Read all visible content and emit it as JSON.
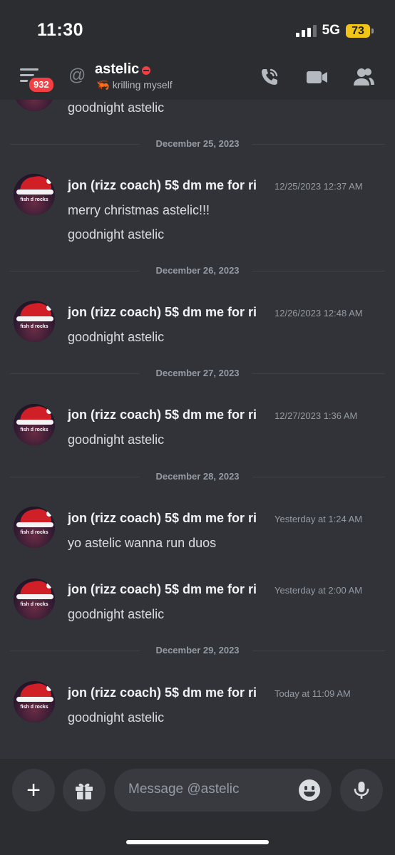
{
  "status_bar": {
    "time": "11:30",
    "network": "5G",
    "battery": "73"
  },
  "header": {
    "unread_badge": "932",
    "at_symbol": "@",
    "username": "astelic",
    "status_emoji": "🦐",
    "status_text": "krilling myself"
  },
  "avatar_text": "fish d  rocks",
  "top_partial_message": "goodnight astelic",
  "dividers": [
    "December 25, 2023",
    "December 26, 2023",
    "December 27, 2023",
    "December 28, 2023",
    "December 29, 2023"
  ],
  "messages": [
    {
      "author": "jon (rizz coach) 5$ dm me for ri",
      "timestamp": "12/25/2023 12:37 AM",
      "lines": [
        "merry christmas astelic!!!",
        "goodnight astelic"
      ]
    },
    {
      "author": "jon (rizz coach) 5$ dm me for ri",
      "timestamp": "12/26/2023 12:48 AM",
      "lines": [
        "goodnight astelic"
      ]
    },
    {
      "author": "jon (rizz coach) 5$ dm me for ri",
      "timestamp": "12/27/2023 1:36 AM",
      "lines": [
        "goodnight astelic"
      ]
    },
    {
      "author": "jon (rizz coach) 5$ dm me for ri",
      "timestamp": "Yesterday at 1:24 AM",
      "lines": [
        "yo astelic wanna run duos"
      ]
    },
    {
      "author": "jon (rizz coach) 5$ dm me for ri",
      "timestamp": "Yesterday at 2:00 AM",
      "lines": [
        "goodnight astelic"
      ]
    },
    {
      "author": "jon (rizz coach) 5$ dm me for ri",
      "timestamp": "Today at 11:09 AM",
      "lines": [
        "goodnight astelic"
      ]
    }
  ],
  "composer": {
    "placeholder": "Message @astelic"
  },
  "colors": {
    "background": "#313338",
    "header": "#2b2d31",
    "dnd": "#f23f43",
    "battery": "#f0c419"
  },
  "icons": [
    "menu-icon",
    "at-icon",
    "call-icon",
    "video-icon",
    "members-icon",
    "plus-icon",
    "gift-icon",
    "emoji-icon",
    "microphone-icon"
  ]
}
